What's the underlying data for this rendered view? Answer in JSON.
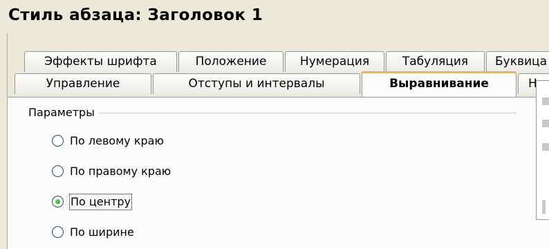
{
  "window": {
    "title": "Стиль абзаца: Заголовок 1"
  },
  "tabs_row1": [
    {
      "label": "Эффекты шрифта"
    },
    {
      "label": "Положение"
    },
    {
      "label": "Нумерация"
    },
    {
      "label": "Табуляция"
    },
    {
      "label": "Буквица"
    }
  ],
  "tabs_row2": [
    {
      "label": "Управление"
    },
    {
      "label": "Отступы и интервалы"
    },
    {
      "label": "Выравнивание",
      "active": true
    },
    {
      "label": "На"
    }
  ],
  "alignment": {
    "group_label": "Параметры",
    "options": [
      {
        "label": "По левому краю",
        "checked": false
      },
      {
        "label": "По правому краю",
        "checked": false
      },
      {
        "label": "По центру",
        "checked": true
      },
      {
        "label": "По ширине",
        "checked": false
      }
    ]
  },
  "colors": {
    "active_tab_accent": "#f7b23a",
    "radio_checked": "#21a121"
  }
}
